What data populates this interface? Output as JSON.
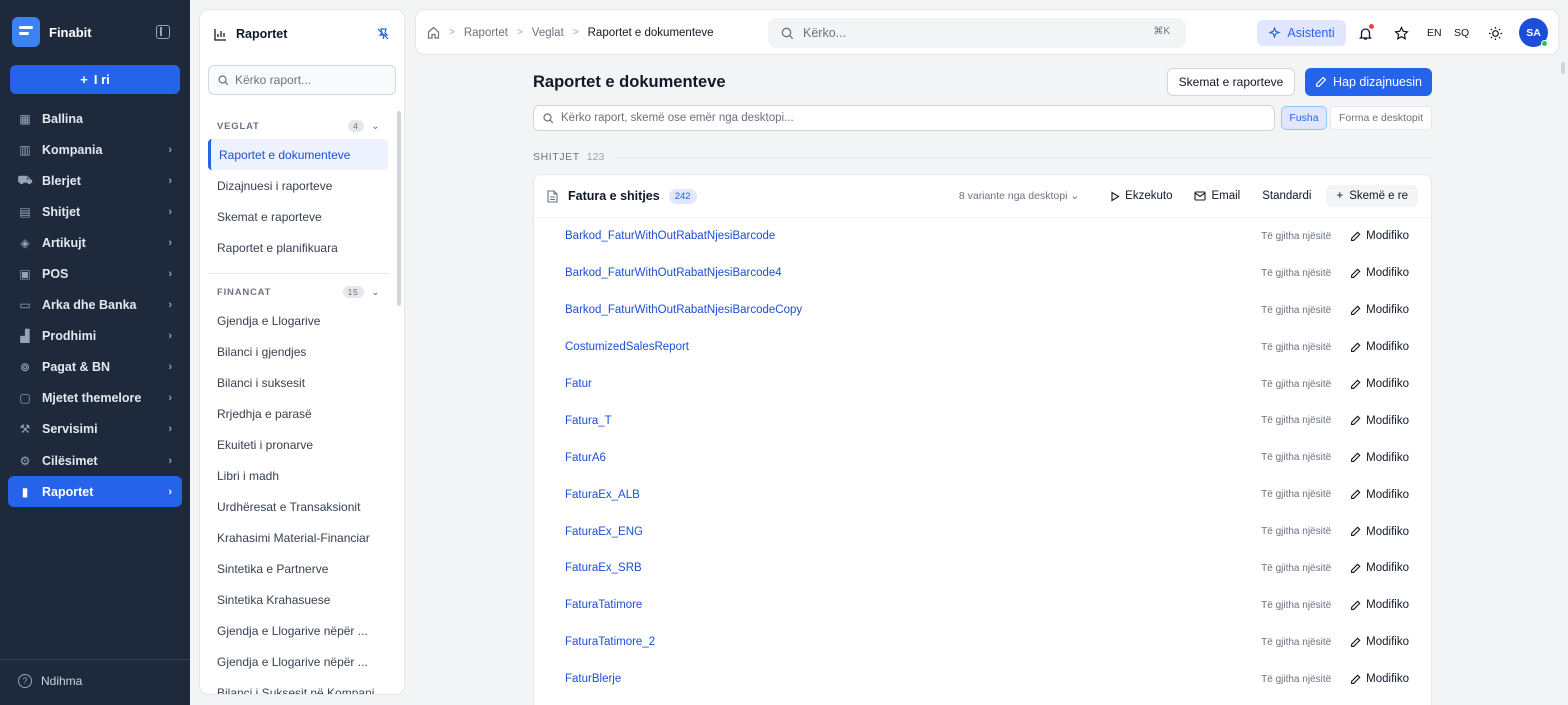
{
  "app": {
    "name": "Finabit"
  },
  "sidebar": {
    "new_label": "I ri",
    "items": [
      {
        "label": "Ballina",
        "icon": "dashboard-icon",
        "chevron": false
      },
      {
        "label": "Kompania",
        "icon": "building-icon",
        "chevron": true
      },
      {
        "label": "Blerjet",
        "icon": "truck-icon",
        "chevron": true
      },
      {
        "label": "Shitjet",
        "icon": "shopping-bag-icon",
        "chevron": true
      },
      {
        "label": "Artikujt",
        "icon": "box-icon",
        "chevron": true
      },
      {
        "label": "POS",
        "icon": "store-icon",
        "chevron": true
      },
      {
        "label": "Arka dhe Banka",
        "icon": "wallet-icon",
        "chevron": true
      },
      {
        "label": "Prodhimi",
        "icon": "factory-icon",
        "chevron": true
      },
      {
        "label": "Pagat & BN",
        "icon": "coins-icon",
        "chevron": true
      },
      {
        "label": "Mjetet themelore",
        "icon": "monitor-icon",
        "chevron": true
      },
      {
        "label": "Servisimi",
        "icon": "wrench-icon",
        "chevron": true
      },
      {
        "label": "Cilësimet",
        "icon": "gear-icon",
        "chevron": true
      },
      {
        "label": "Raportet",
        "icon": "bar-chart-icon",
        "chevron": true,
        "active": true
      }
    ],
    "help_label": "Ndihma"
  },
  "reports_panel": {
    "title": "Raportet",
    "search_placeholder": "Kërko raport...",
    "sections": [
      {
        "name": "VEGLAT",
        "count": "4",
        "items": [
          "Raportet e dokumenteve",
          "Dizajnuesi i raporteve",
          "Skemat e raporteve",
          "Raportet e planifikuara"
        ]
      },
      {
        "name": "FINANCAT",
        "count": "15",
        "items": [
          "Gjendja e Llogarive",
          "Bilanci i gjendjes",
          "Bilanci i suksesit",
          "Rrjedhja e parasë",
          "Ekuiteti i pronarve",
          "Libri i madh",
          "Urdhëresat e Transaksionit",
          "Krahasimi Material-Financiar",
          "Sintetika e Partnerve",
          "Sintetika Krahasuese",
          "Gjendja e Llogarive nëpër ...",
          "Gjendja e Llogarive nëpër ...",
          "Bilanci i Suksesit në Kompani"
        ]
      }
    ]
  },
  "topbar": {
    "breadcrumb": [
      "Raportet",
      "Veglat",
      "Raportet e dokumenteve"
    ],
    "search_placeholder": "Kërko...",
    "shortcut": "⌘K",
    "assistant_label": "Asistenti",
    "lang_en": "EN",
    "lang_sq": "SQ",
    "avatar_initials": "SA"
  },
  "main": {
    "title": "Raportet e dokumenteve",
    "schemes_button": "Skemat e raporteve",
    "designer_button": "Hap dizajnuesin",
    "filter_placeholder": "Kërko raport, skemë ose emër nga desktopi...",
    "segment_on": "Fusha",
    "segment_off": "Forma e desktopit",
    "group": {
      "name": "SHITJET",
      "count": "123"
    },
    "card": {
      "title": "Fatura e shitjes",
      "count": "242",
      "variants": "8 variante nga desktopi",
      "run": "Ekzekuto",
      "email": "Email",
      "standard": "Standardi",
      "new_scheme": "Skemë e re",
      "scope_label": "Të gjitha njësitë",
      "edit_label": "Modifiko",
      "rows": [
        "Barkod_FaturWithOutRabatNjesiBarcode",
        "Barkod_FaturWithOutRabatNjesiBarcode4",
        "Barkod_FaturWithOutRabatNjesiBarcodeCopy",
        "CostumizedSalesReport",
        "Fatur",
        "Fatura_T",
        "FaturA6",
        "FaturaEx_ALB",
        "FaturaEx_ENG",
        "FaturaEx_SRB",
        "FaturaTatimore",
        "FaturaTatimore_2",
        "FaturBlerje"
      ]
    }
  },
  "colors": {
    "accent": "#2563eb",
    "sidebar_bg": "#1e293b",
    "link": "#1d4ed8"
  }
}
